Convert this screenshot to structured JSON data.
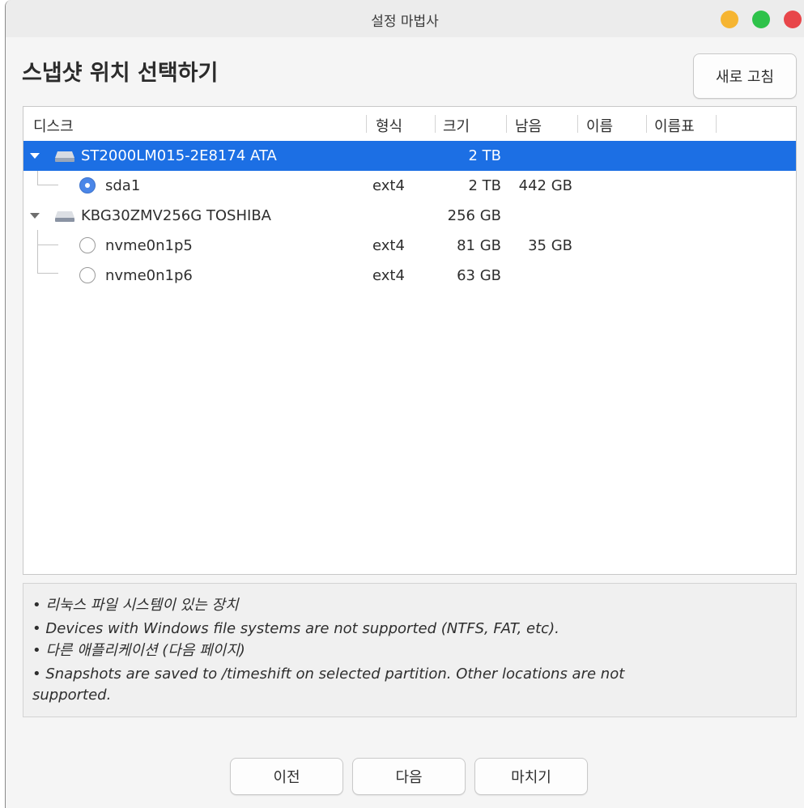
{
  "window": {
    "title": "설정 마법사",
    "controls": [
      "minimize",
      "maximize",
      "close"
    ],
    "control_colors": {
      "minimize": "#f6b532",
      "maximize": "#2ec24a",
      "close": "#e8464a"
    }
  },
  "page": {
    "heading": "스냅샷 위치 선택하기",
    "refresh_label": "새로 고침"
  },
  "table": {
    "columns": [
      "디스크",
      "형식",
      "크기",
      "남음",
      "이름",
      "이름표"
    ],
    "rows": [
      {
        "kind": "disk",
        "name": "ST2000LM015-2E8174 ATA",
        "type": "",
        "size": "2 TB",
        "free": "",
        "label": "",
        "tag": "",
        "selected": true,
        "expanded": true
      },
      {
        "kind": "partition",
        "name": "sda1",
        "type": "ext4",
        "size": "2 TB",
        "free": "442 GB",
        "label": "",
        "tag": "",
        "checked": true
      },
      {
        "kind": "disk",
        "name": "KBG30ZMV256G TOSHIBA",
        "type": "",
        "size": "256 GB",
        "free": "",
        "label": "",
        "tag": "",
        "selected": false,
        "expanded": true
      },
      {
        "kind": "partition",
        "name": "nvme0n1p5",
        "type": "ext4",
        "size": "81 GB",
        "free": "35 GB",
        "label": "",
        "tag": "",
        "checked": false
      },
      {
        "kind": "partition",
        "name": "nvme0n1p6",
        "type": "ext4",
        "size": "63 GB",
        "free": "",
        "label": "",
        "tag": "",
        "checked": false
      }
    ],
    "selection_color": "#1c6fe4"
  },
  "notes": [
    "• 리눅스 파일 시스템이 있는 장치",
    "• Devices with Windows file systems are not supported (NTFS, FAT, etc).",
    "• 다른 애플리케이션 (다음 페이지)",
    "• Snapshots are saved to /timeshift on selected partition. Other locations are not",
    "supported."
  ],
  "footer": {
    "prev_label": "이전",
    "next_label": "다음",
    "finish_label": "마치기"
  }
}
